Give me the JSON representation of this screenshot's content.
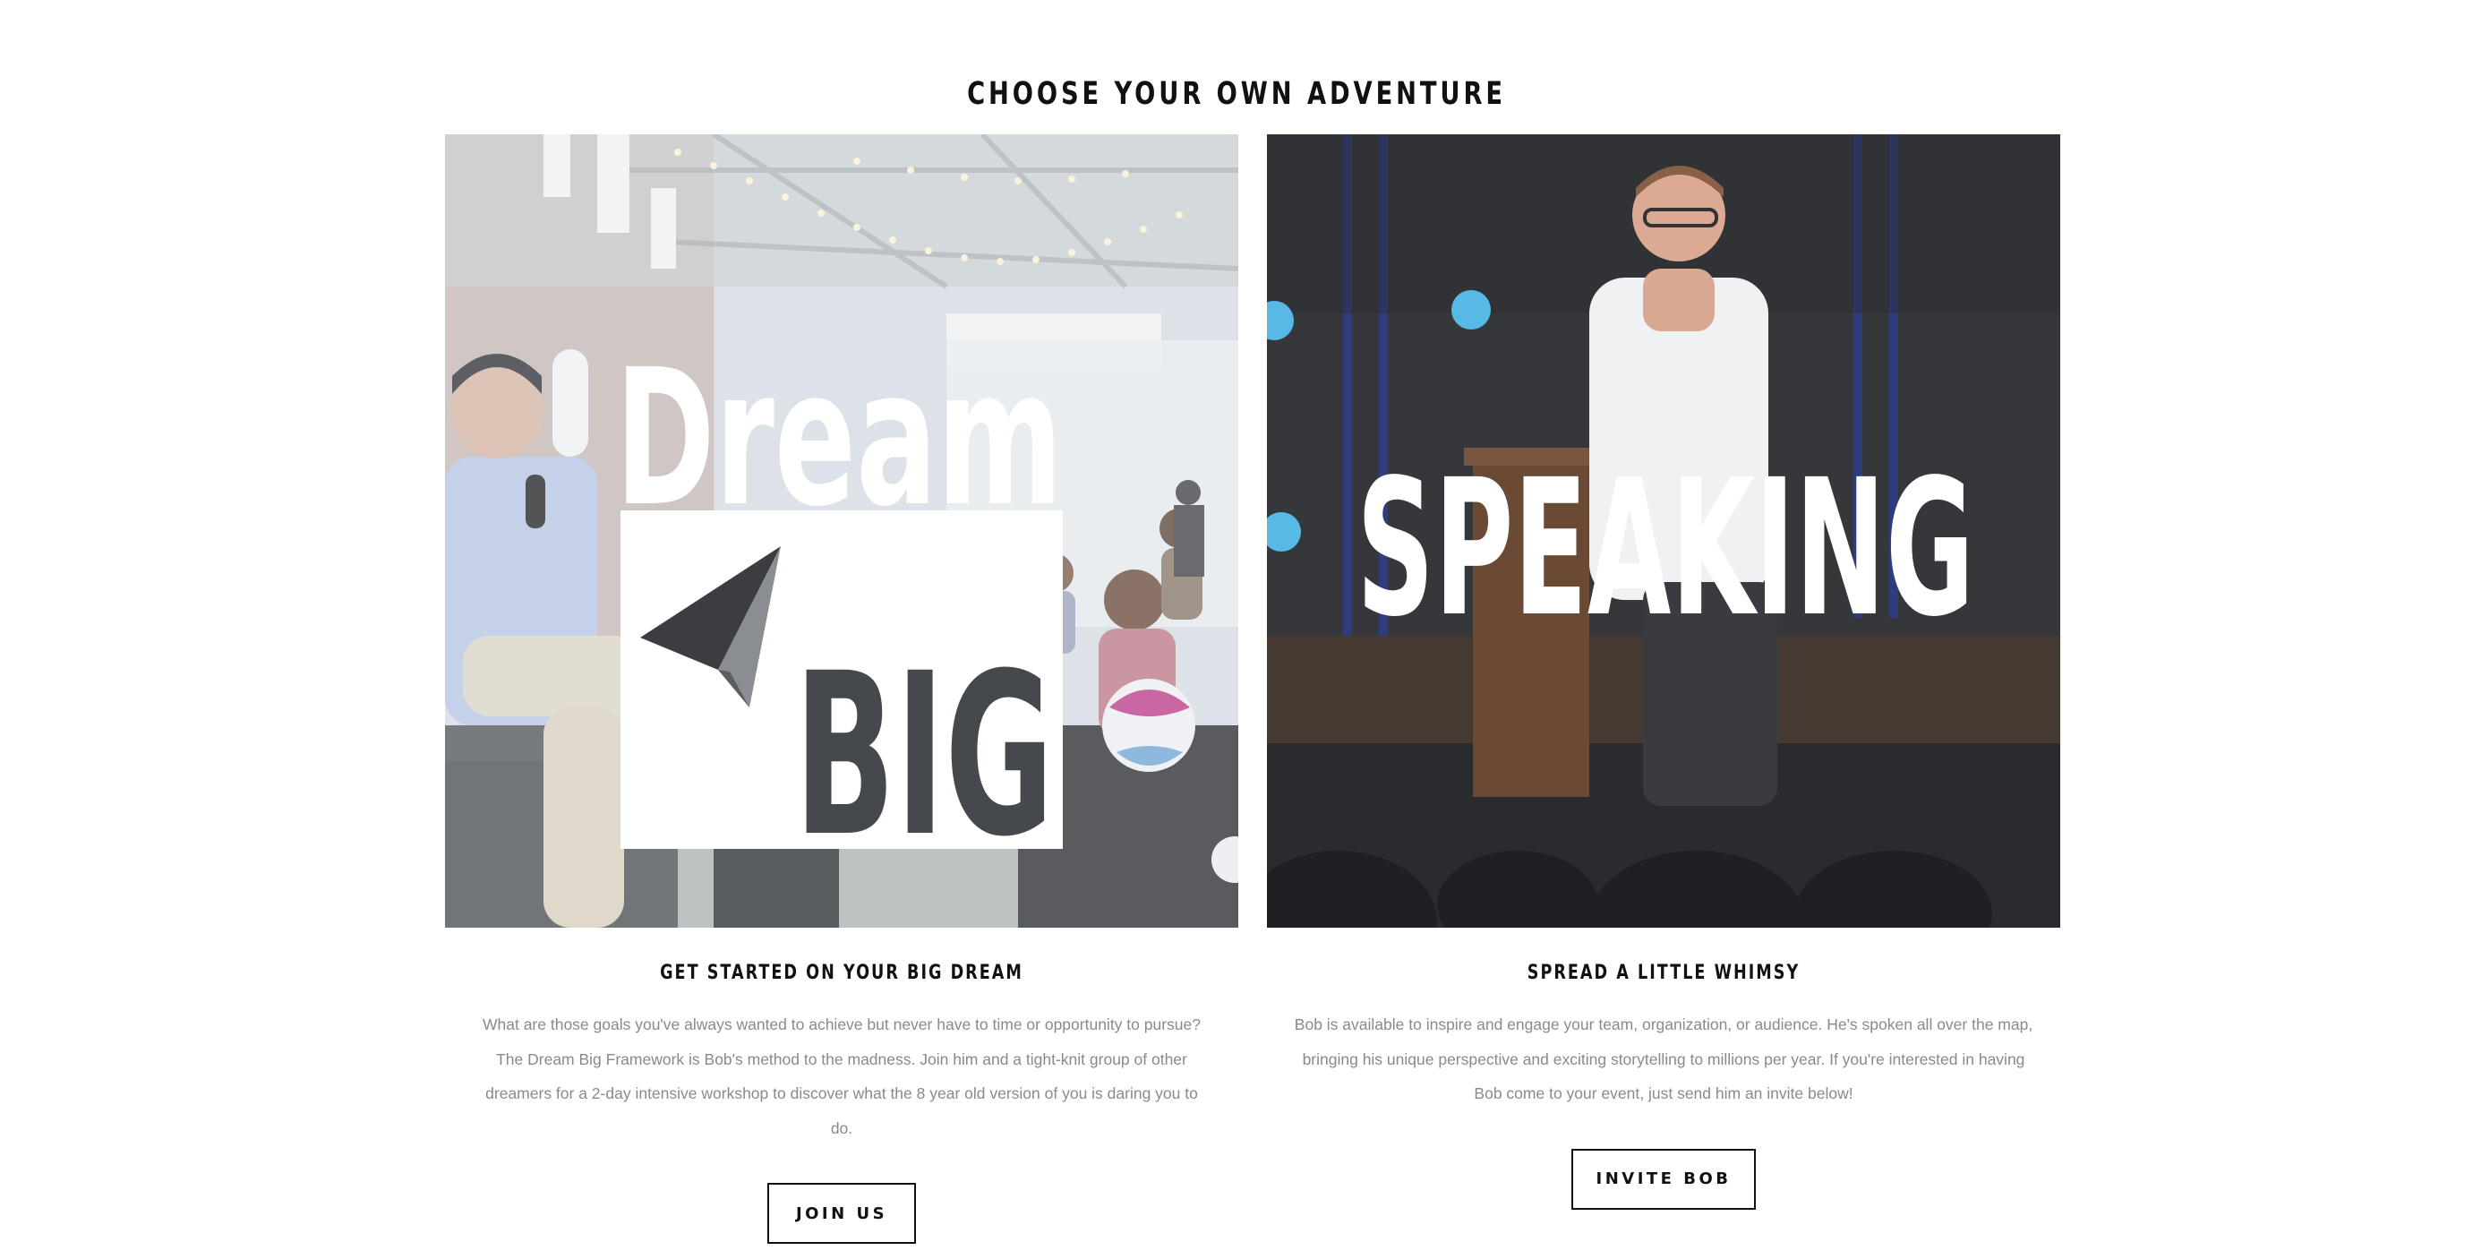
{
  "page": {
    "title": "CHOOSE YOUR OWN ADVENTURE"
  },
  "cards": [
    {
      "image_words": [
        "Dream",
        "BIG"
      ],
      "heading": "GET STARTED ON YOUR BIG DREAM",
      "body_lines": [
        "What are those goals you've always wanted to achieve but never have to time or opportunity to pursue?",
        "The Dream Big Framework is Bob's method to the madness. Join him and a tight-knit group of other",
        "dreamers for a 2-day intensive workshop to discover what the 8 year old version of you is daring you to",
        "do."
      ],
      "button": "JOIN US"
    },
    {
      "image_words": [
        "SPEAKING"
      ],
      "heading": "SPREAD A LITTLE WHIMSY",
      "body_lines": [
        "Bob is available to inspire and engage your team, organization, or audience. He's spoken all over the map,",
        "bringing his unique perspective and exciting storytelling to millions per year. If you're interested in having",
        "Bob come to your event, just send him an invite below!"
      ],
      "button": "INVITE BOB"
    }
  ],
  "colors": {
    "heading_text": "#111111",
    "body_text": "#8a8a8a",
    "button_border": "#111111",
    "dream_image_overlay": "#dfe6ec",
    "speaking_image_bg": "#3a3b3e"
  }
}
